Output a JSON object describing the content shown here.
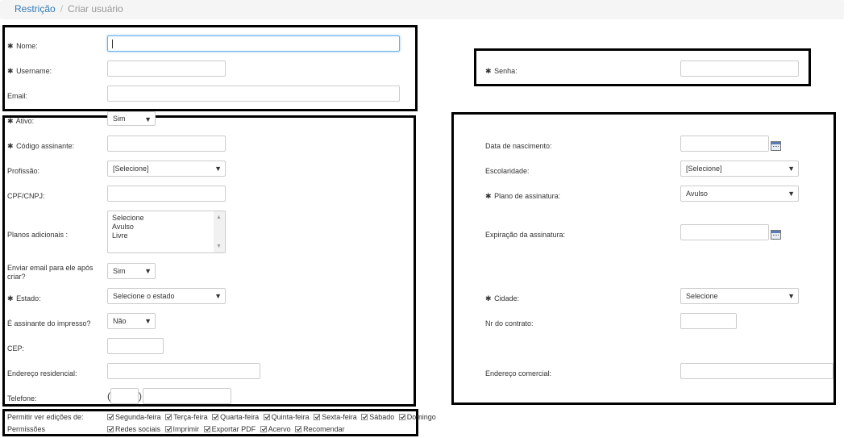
{
  "breadcrumb": {
    "root": "Restrição",
    "separator": "/",
    "current": "Criar usuário"
  },
  "required_mark": "✱",
  "form": {
    "nome": {
      "label": "Nome:",
      "value": ""
    },
    "username": {
      "label": "Username:",
      "value": ""
    },
    "email": {
      "label": "Email:",
      "value": ""
    },
    "senha": {
      "label": "Senha:",
      "value": ""
    },
    "ativo": {
      "label": "Ativo:",
      "value": "Sim"
    },
    "codigo_assinante": {
      "label": "Código assinante:",
      "value": ""
    },
    "profissao": {
      "label": "Profissão:",
      "value": "[Selecione]"
    },
    "cpf_cnpj": {
      "label": "CPF/CNPJ:",
      "value": ""
    },
    "planos_adicionais": {
      "label": "Planos adicionais :",
      "options": [
        "Selecione",
        "Avulso",
        "Livre"
      ]
    },
    "enviar_email": {
      "label": "Enviar email para ele após criar?",
      "value": "Sim"
    },
    "estado": {
      "label": "Estado:",
      "value": "Selecione o estado"
    },
    "assinante_impresso": {
      "label": "É assinante do impresso?",
      "value": "Não"
    },
    "cep": {
      "label": "CEP:",
      "value": ""
    },
    "endereco_residencial": {
      "label": "Endereço residencial:",
      "value": ""
    },
    "telefone": {
      "label": "Telefone:",
      "open_paren": "(",
      "close_paren": ")",
      "ddd": "",
      "numero": ""
    },
    "data_nascimento": {
      "label": "Data de nascimento:",
      "value": ""
    },
    "escolaridade": {
      "label": "Escolaridade:",
      "value": "[Selecione]"
    },
    "plano_assinatura": {
      "label": "Plano de assinatura:",
      "value": "Avulso"
    },
    "expiracao_assinatura": {
      "label": "Expiração da assinatura:",
      "value": ""
    },
    "cidade": {
      "label": "Cidade:",
      "value": "Selecione"
    },
    "nr_contrato": {
      "label": "Nr do contrato:",
      "value": ""
    },
    "endereco_comercial": {
      "label": "Endereço comercial:",
      "value": ""
    }
  },
  "edicoes": {
    "label": "Permitir ver edições de:",
    "days": [
      "Segunda-feira",
      "Terça-feira",
      "Quarta-feira",
      "Quinta-feira",
      "Sexta-feira",
      "Sábado",
      "Domingo"
    ]
  },
  "permissoes": {
    "label": "Permissões",
    "items": [
      "Redes sociais",
      "Imprimir",
      "Exportar PDF",
      "Acervo",
      "Recomendar"
    ]
  },
  "icons": {
    "dropdown_arrow": "▼",
    "list_up": "▲",
    "list_down": "▼",
    "calendar": "calendar-icon"
  },
  "colors": {
    "link": "#337ab7",
    "focus": "#66afe9",
    "frame": "#000000"
  }
}
